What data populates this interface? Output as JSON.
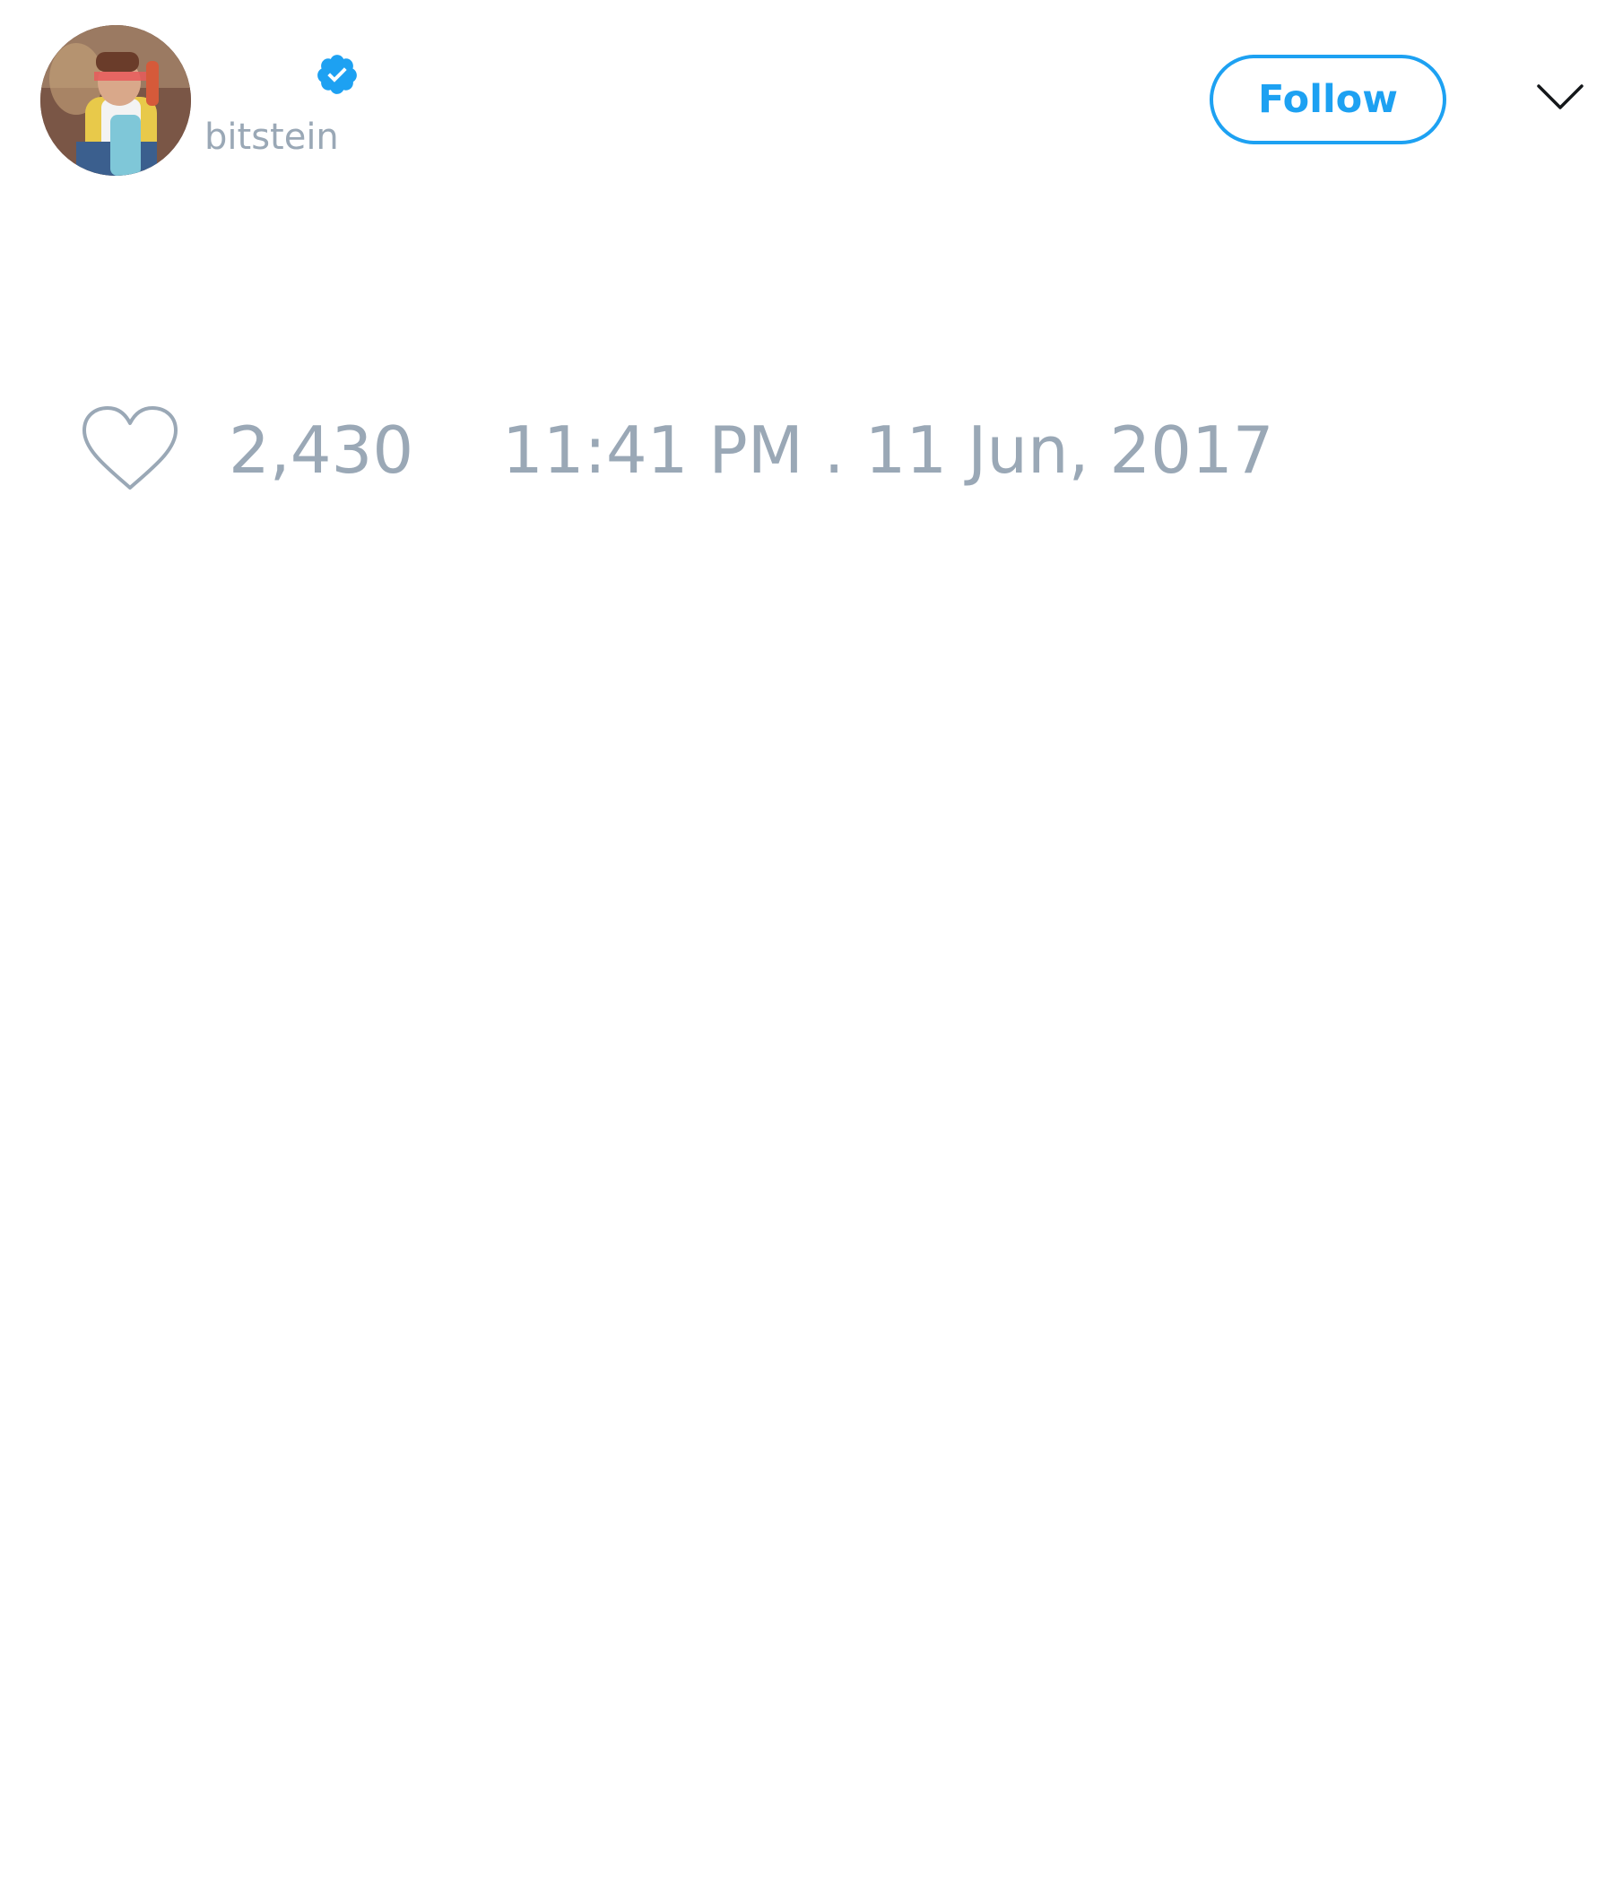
{
  "user": {
    "handle": "bitstein",
    "verified": true,
    "avatar_icon": "avatar-photo"
  },
  "header": {
    "follow_label": "Follow",
    "more_icon": "chevron-down-icon"
  },
  "actions": {
    "like_icon": "heart-outline-icon",
    "like_count": "2,430",
    "timestamp": "11:41 PM . 11 Jun, 2017"
  },
  "colors": {
    "accent": "#1da1f2",
    "muted_text": "#9aa8b6",
    "background": "#ffffff"
  }
}
